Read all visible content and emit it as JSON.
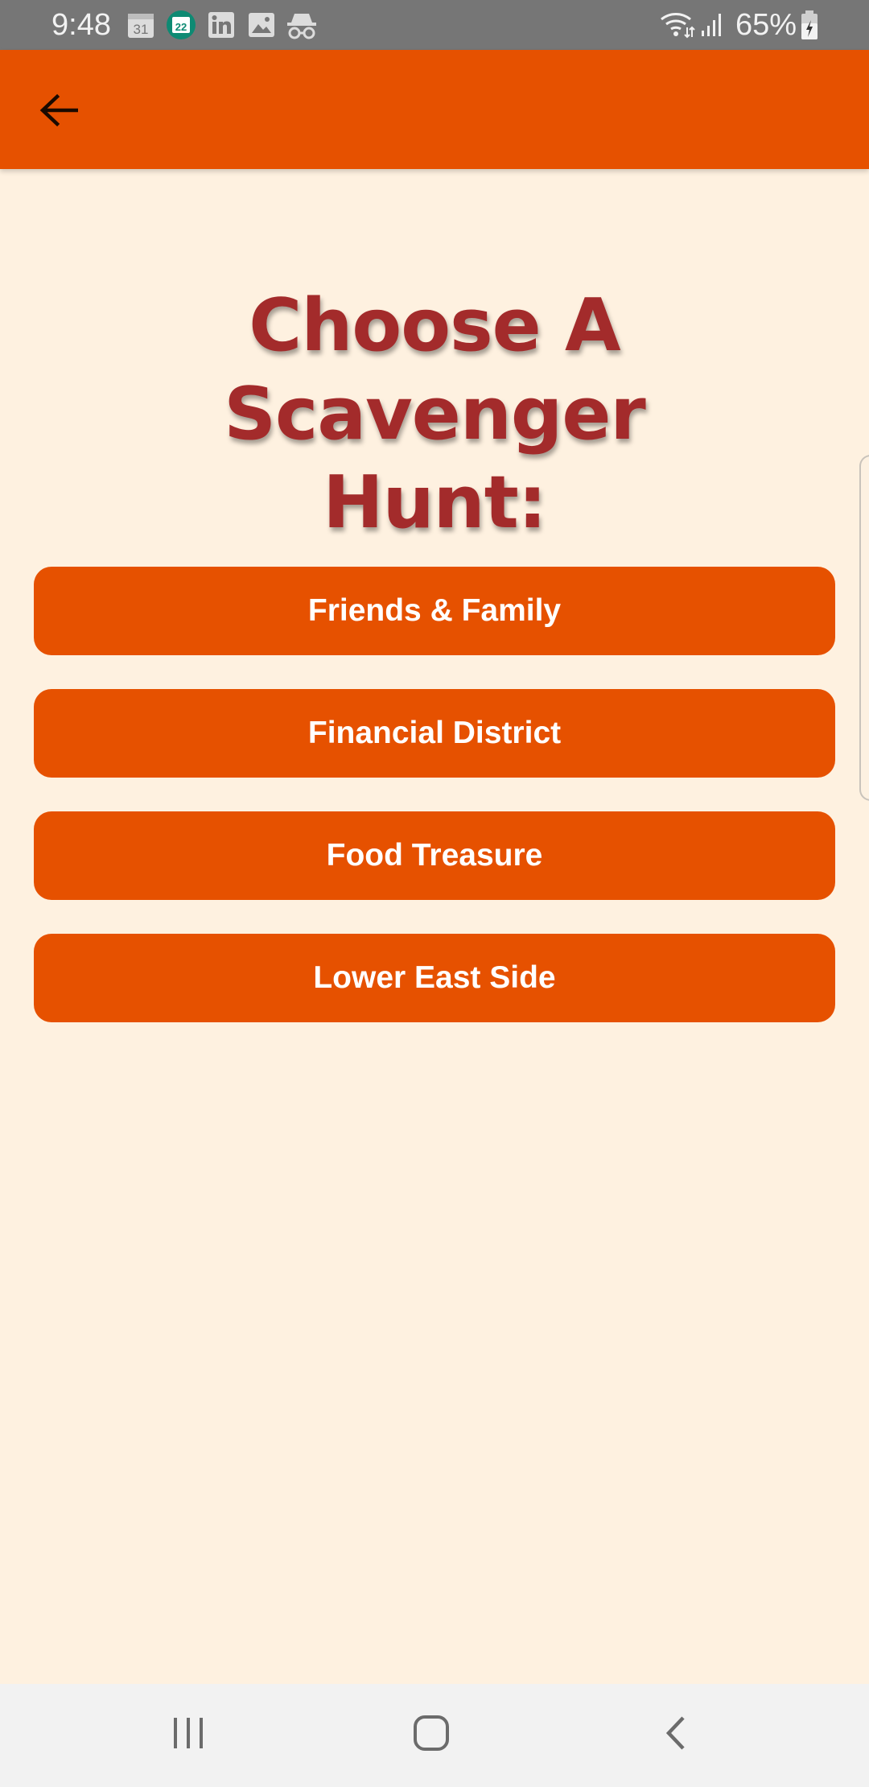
{
  "status_bar": {
    "time": "9:48",
    "battery_text": "65%",
    "icons": [
      "calendar-31-icon",
      "calendar-22-icon",
      "linkedin-icon",
      "image-icon",
      "incognito-icon",
      "wifi-icon",
      "signal-icon",
      "battery-charging-icon"
    ],
    "calendar_day_1": "31",
    "calendar_day_2": "22"
  },
  "app_bar": {
    "back_icon": "arrow-left-icon",
    "color": "#E65100"
  },
  "main": {
    "title_line1": "Choose A Scavenger",
    "title_line2": "Hunt:",
    "title_color": "#A32B2B",
    "background_color": "#FEF1E0",
    "hunts": [
      {
        "label": "Friends & Family"
      },
      {
        "label": "Financial District"
      },
      {
        "label": "Food Treasure"
      },
      {
        "label": "Lower East Side"
      }
    ]
  },
  "nav_bar": {
    "icons": [
      "recent-apps-icon",
      "home-icon",
      "back-icon"
    ]
  }
}
